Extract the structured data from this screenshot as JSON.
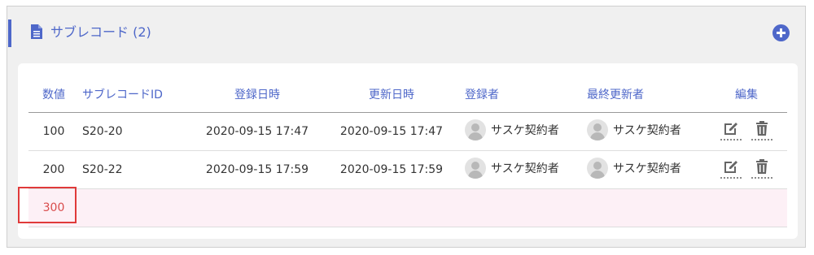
{
  "panel": {
    "title": "サブレコード (2)",
    "icons": {
      "title": "document-icon",
      "add": "plus-circle-icon"
    }
  },
  "table": {
    "headers": [
      "数値",
      "サブレコードID",
      "登録日時",
      "更新日時",
      "登録者",
      "最終更新者",
      "編集"
    ],
    "rows": [
      {
        "value": "100",
        "id": "S20-20",
        "created": "2020-09-15 17:47",
        "updated": "2020-09-15 17:47",
        "creator": "サスケ契約者",
        "updater": "サスケ契約者"
      },
      {
        "value": "200",
        "id": "S20-22",
        "created": "2020-09-15 17:59",
        "updated": "2020-09-15 17:59",
        "creator": "サスケ契約者",
        "updater": "サスケ契約者"
      }
    ],
    "new_row": {
      "value": "300"
    }
  },
  "colors": {
    "accent": "#4e67c9",
    "new_row_bg": "#fdf0f6",
    "highlight": "#e03a3a"
  }
}
